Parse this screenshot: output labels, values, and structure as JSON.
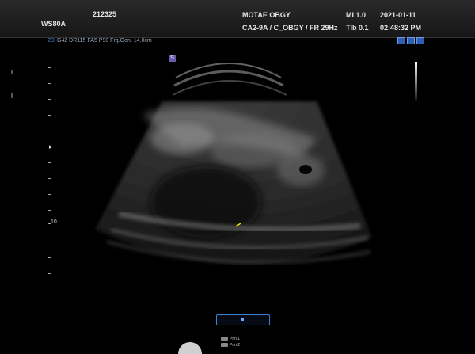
{
  "header": {
    "id_label": "WS80A",
    "patient_id": "212325",
    "institution": "MOTAE OBGY",
    "probe_preset": "CA2-9A / C_OBGY / FR 29Hz",
    "mi": "MI  1.0",
    "tib": "TIb 0.1",
    "date": "2021-01-11",
    "time": "02:48:32 PM"
  },
  "image_info": {
    "mode_label": "2D",
    "params": "G42 DR115 FA5 P90 Frq.Gen. 14.0cm"
  },
  "depth_scale": {
    "labels": [
      "10"
    ]
  },
  "markers": {
    "image_marker": "S"
  },
  "footer": {
    "print1": "Print1",
    "print2": "Print2"
  },
  "colors": {
    "accent": "#3b82d6",
    "marker": "#6b5aa8",
    "header_bg": "#1e1e1e"
  }
}
